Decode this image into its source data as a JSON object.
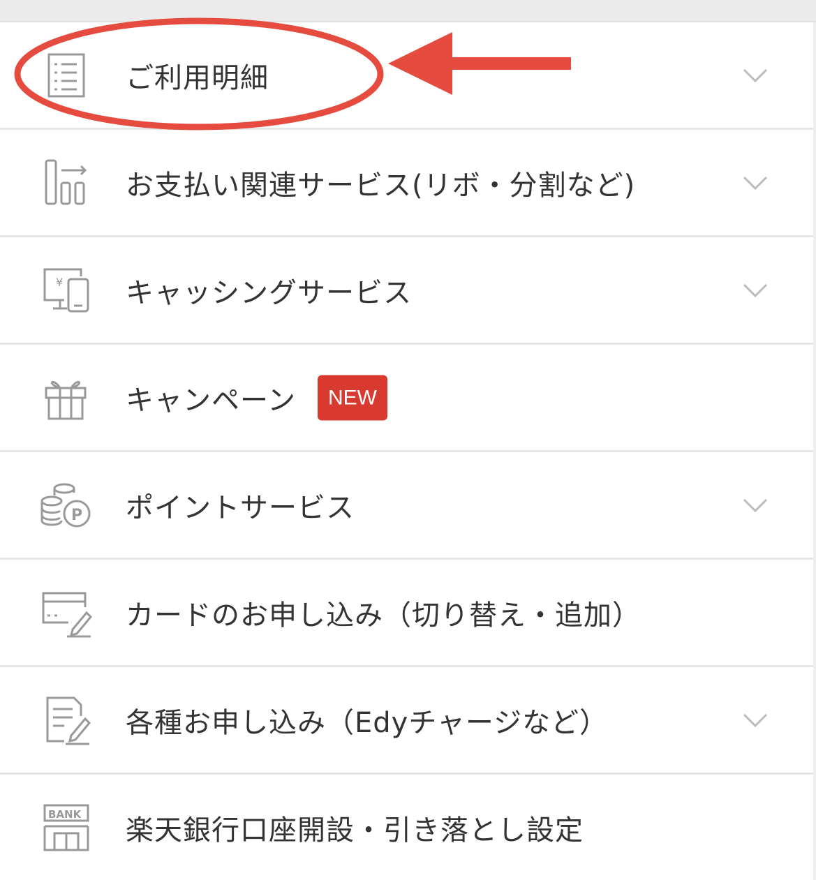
{
  "menu": {
    "items": [
      {
        "label": "ご利用明細",
        "icon": "statement-list-icon",
        "has_chevron": true
      },
      {
        "label": "お支払い関連サービス(リボ・分割など)",
        "icon": "payment-services-icon",
        "has_chevron": true
      },
      {
        "label": "キャッシングサービス",
        "icon": "cashing-icon",
        "has_chevron": true
      },
      {
        "label": "キャンペーン",
        "icon": "gift-icon",
        "has_chevron": false,
        "badge": "NEW"
      },
      {
        "label": "ポイントサービス",
        "icon": "points-coins-icon",
        "has_chevron": true
      },
      {
        "label": "カードのお申し込み（切り替え・追加）",
        "icon": "card-application-icon",
        "has_chevron": false
      },
      {
        "label": "各種お申し込み（Edyチャージなど）",
        "icon": "document-edit-icon",
        "has_chevron": true
      },
      {
        "label": "楽天銀行口座開設・引き落とし設定",
        "icon": "bank-icon",
        "has_chevron": false
      }
    ]
  },
  "colors": {
    "text": "#333333",
    "icon": "#999999",
    "divider": "#e6e6e6",
    "badge": "#d93a2f",
    "annotation": "#e54b3e",
    "chevron": "#bbbbbb"
  },
  "icons": {
    "chevron": "chevron-down-icon"
  }
}
